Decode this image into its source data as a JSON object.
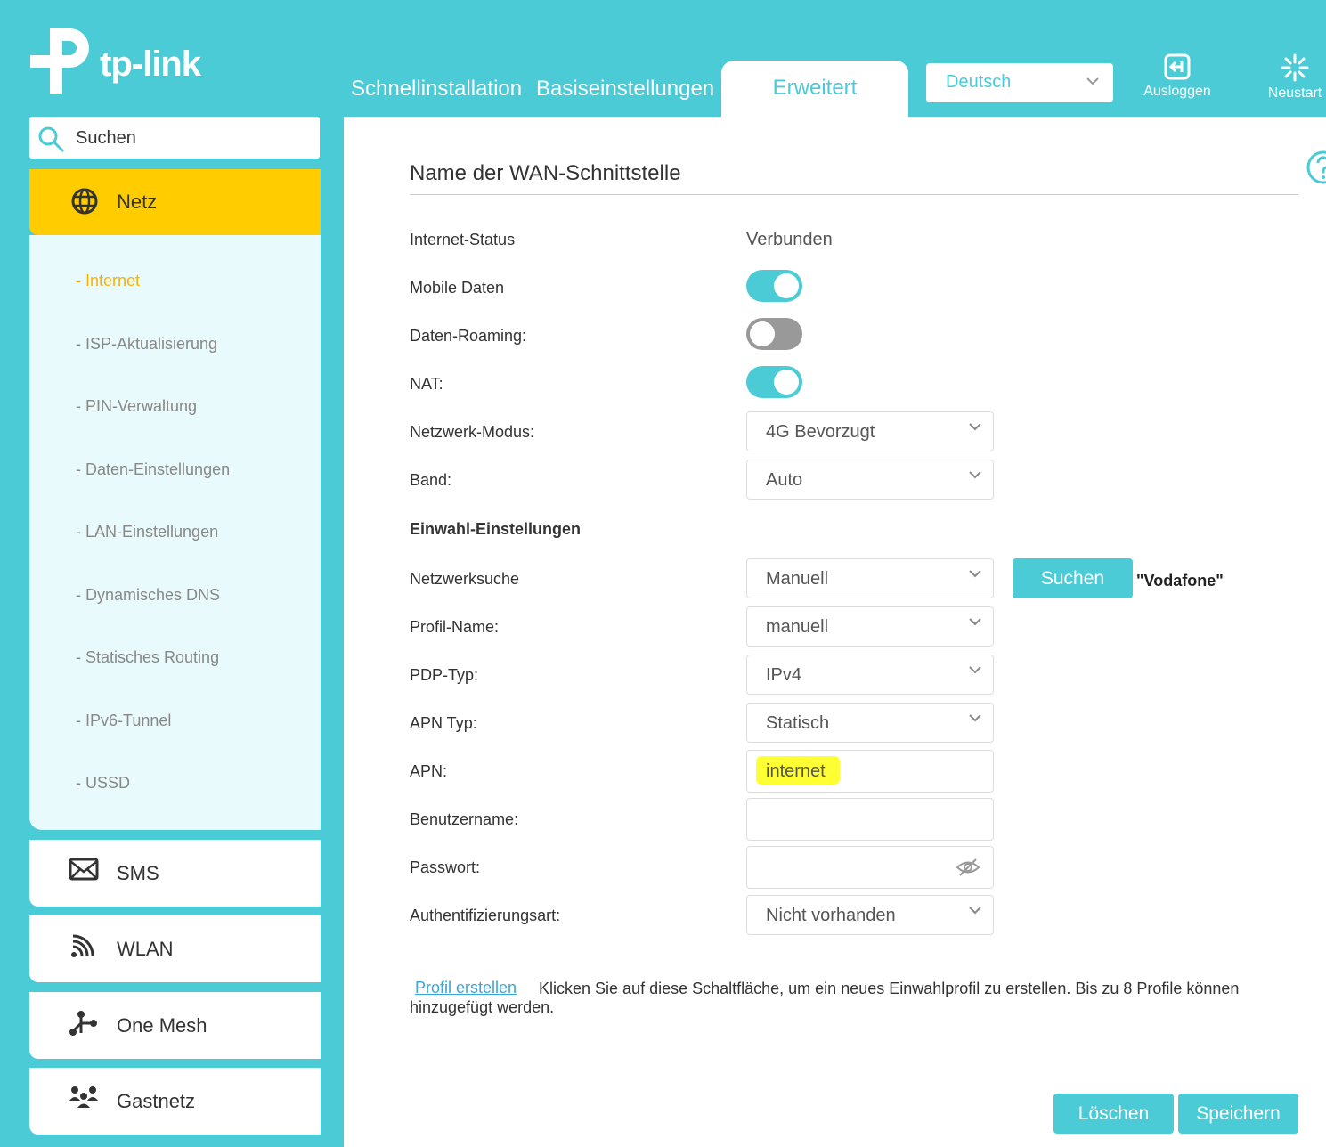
{
  "brand": {
    "logo_text": "tp-link"
  },
  "nav": {
    "tabs": [
      {
        "label": "Schnellinstallation"
      },
      {
        "label": "Basiseinstellungen"
      },
      {
        "label": "Erweitert"
      }
    ],
    "language": "Deutsch",
    "logout_label": "Ausloggen",
    "restart_label": "Neustart"
  },
  "sidebar": {
    "search_placeholder": "Suchen",
    "section": "Netz",
    "subitems": [
      {
        "label": "- Internet"
      },
      {
        "label": "- ISP-Aktualisierung"
      },
      {
        "label": "- PIN-Verwaltung"
      },
      {
        "label": "- Daten-Einstellungen"
      },
      {
        "label": "- LAN-Einstellungen"
      },
      {
        "label": "- Dynamisches DNS"
      },
      {
        "label": "- Statisches Routing"
      },
      {
        "label": "- IPv6-Tunnel"
      },
      {
        "label": "- USSD"
      }
    ],
    "cards": [
      {
        "label": "SMS"
      },
      {
        "label": "WLAN"
      },
      {
        "label": "One Mesh"
      },
      {
        "label": "Gastnetz"
      }
    ]
  },
  "main": {
    "title": "Name der WAN-Schnittstelle",
    "internet_status_label": "Internet-Status",
    "internet_status_value": "Verbunden",
    "mobile_data_label": "Mobile Daten",
    "mobile_data_on": true,
    "roaming_label": "Daten-Roaming:",
    "roaming_on": false,
    "nat_label": "NAT:",
    "nat_on": true,
    "network_mode_label": "Netzwerk-Modus:",
    "network_mode_value": "4G Bevorzugt",
    "band_label": "Band:",
    "band_value": "Auto",
    "dialup_heading": "Einwahl-Einstellungen",
    "network_search_label": "Netzwerksuche",
    "network_search_value": "Manuell",
    "search_button": "Suchen",
    "network_found": "\"Vodafone\"",
    "profile_name_label": "Profil-Name:",
    "profile_name_value": "manuell",
    "pdp_label": "PDP-Typ:",
    "pdp_value": "IPv4",
    "apn_type_label": "APN Typ:",
    "apn_type_value": "Statisch",
    "apn_label": "APN:",
    "apn_value": "internet",
    "username_label": "Benutzername:",
    "username_value": "",
    "password_label": "Passwort:",
    "password_value": "",
    "auth_label": "Authentifizierungsart:",
    "auth_value": "Nicht vorhanden",
    "profile_create_link": "Profil erstellen",
    "profile_create_text": "Klicken Sie auf diese Schaltfläche, um ein neues Einwahlprofil zu erstellen. Bis zu 8 Profile können hinzugefügt werden.",
    "delete_button": "Löschen",
    "save_button": "Speichern"
  },
  "colors": {
    "accent": "#4acbd6",
    "highlight": "#ffcc00",
    "active_link": "#f5b400"
  }
}
